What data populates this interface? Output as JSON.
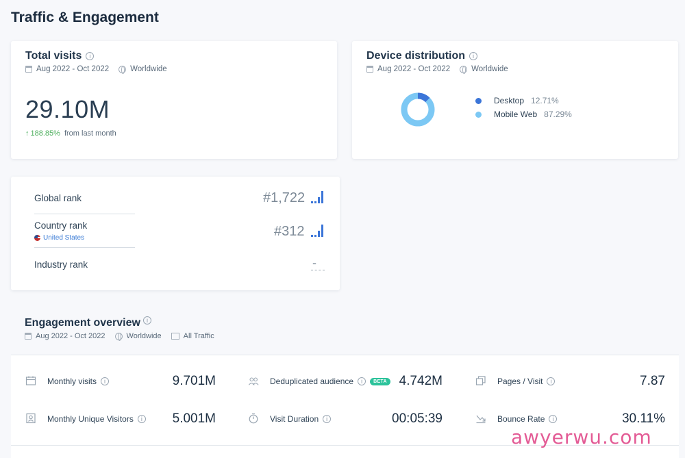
{
  "page": {
    "title": "Traffic & Engagement"
  },
  "total_visits": {
    "title": "Total visits",
    "date_range": "Aug 2022 - Oct 2022",
    "region": "Worldwide",
    "value": "29.10M",
    "change": "188.85%",
    "change_note": "from last month"
  },
  "device_distribution": {
    "title": "Device distribution",
    "date_range": "Aug 2022 - Oct 2022",
    "region": "Worldwide",
    "items": [
      {
        "label": "Desktop",
        "value": "12.71%",
        "fraction": 0.1271,
        "color": "#3b75d8"
      },
      {
        "label": "Mobile Web",
        "value": "87.29%",
        "fraction": 0.8729,
        "color": "#7cc8f4"
      }
    ]
  },
  "ranks": {
    "global": {
      "label": "Global rank",
      "value": "#1,722"
    },
    "country": {
      "label": "Country rank",
      "country": "United States",
      "value": "#312"
    },
    "industry": {
      "label": "Industry rank",
      "value": "-"
    }
  },
  "engagement": {
    "title": "Engagement overview",
    "date_range": "Aug 2022 - Oct 2022",
    "region": "Worldwide",
    "traffic": "All Traffic",
    "monthly_visits": {
      "label": "Monthly visits",
      "value": "9.701M"
    },
    "dedup_audience": {
      "label": "Deduplicated audience",
      "badge": "BETA",
      "value": "4.742M"
    },
    "pages_per_visit": {
      "label": "Pages / Visit",
      "value": "7.87"
    },
    "unique_visitors": {
      "label": "Monthly Unique Visitors",
      "value": "5.001M"
    },
    "visit_duration": {
      "label": "Visit Duration",
      "value": "00:05:39"
    },
    "bounce_rate": {
      "label": "Bounce Rate",
      "value": "30.11%"
    }
  },
  "watermark": "awyerwu.com"
}
